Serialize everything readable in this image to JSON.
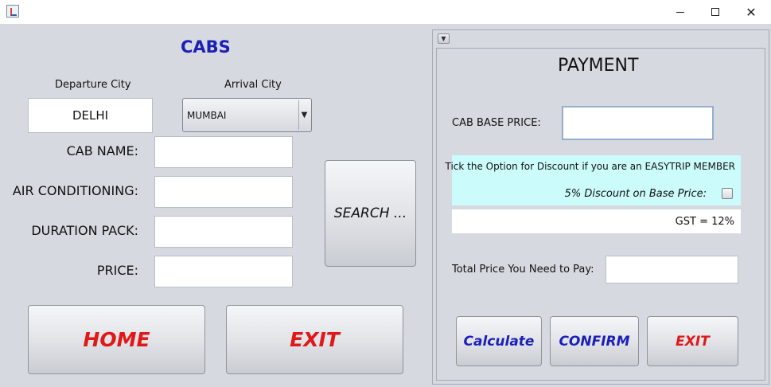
{
  "window": {
    "title": ""
  },
  "left": {
    "title": "CABS",
    "departure_label": "Departure City",
    "arrival_label": "Arrival City",
    "departure_value": "DELHI",
    "arrival_value": "MUMBAI",
    "cab_name_label": "CAB NAME:",
    "ac_label": "AIR CONDITIONING:",
    "duration_label": "DURATION PACK:",
    "price_label": "PRICE:",
    "cab_name_value": "",
    "ac_value": "",
    "duration_value": "",
    "price_value": "",
    "search_label": "SEARCH ...",
    "home_label": "HOME",
    "exit_label": "EXIT"
  },
  "payment": {
    "title": "PAYMENT",
    "base_price_label": "CAB BASE PRICE:",
    "base_price_value": "",
    "discount_info": "Tick the Option for Discount if you are an EASYTRIP MEMBER",
    "discount_option": "5% Discount on Base Price:",
    "discount_checked": false,
    "gst_text": "GST = 12%",
    "total_label": "Total Price You Need to Pay:",
    "total_value": "",
    "calculate_label": "Calculate",
    "confirm_label": "CONFIRM",
    "exit_label": "EXIT"
  },
  "colors": {
    "title_blue": "#1a1fb8",
    "exit_red": "#e01818",
    "discount_bg": "#ccfbfb",
    "window_bg": "#d6d9df"
  },
  "icons": {
    "app": "java-app-icon",
    "minimize": "minimize-icon",
    "maximize": "maximize-icon",
    "close": "close-icon"
  }
}
